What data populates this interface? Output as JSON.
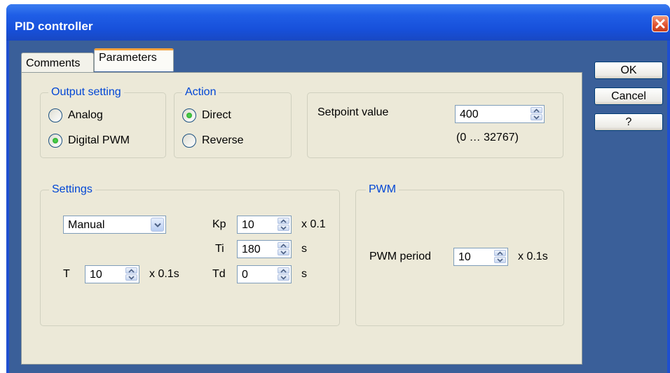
{
  "window": {
    "title": "PID controller"
  },
  "tabs": [
    {
      "label": "Comments",
      "active": false
    },
    {
      "label": "Parameters",
      "active": true
    }
  ],
  "buttons": {
    "ok": "OK",
    "cancel": "Cancel",
    "help": "?"
  },
  "output_setting": {
    "legend": "Output setting",
    "options": [
      {
        "label": "Analog",
        "checked": false
      },
      {
        "label": "Digital PWM",
        "checked": true
      }
    ]
  },
  "action": {
    "legend": "Action",
    "options": [
      {
        "label": "Direct",
        "checked": true
      },
      {
        "label": "Reverse",
        "checked": false
      }
    ]
  },
  "setpoint": {
    "label": "Setpoint value",
    "value": "400",
    "range": "(0 … 32767)"
  },
  "settings": {
    "legend": "Settings",
    "mode": "Manual",
    "kp": {
      "label": "Kp",
      "value": "10",
      "unit": "x 0.1"
    },
    "ti": {
      "label": "Ti",
      "value": "180",
      "unit": "s"
    },
    "td": {
      "label": "Td",
      "value": "0",
      "unit": "s"
    },
    "t": {
      "label": "T",
      "value": "10",
      "unit": "x 0.1s"
    }
  },
  "pwm": {
    "legend": "PWM",
    "period": {
      "label": "PWM period",
      "value": "10",
      "unit": "x 0.1s"
    }
  },
  "colors": {
    "titlebar": "#1f5ee6",
    "legend_text": "#0046d5",
    "panel": "#ece9d8",
    "radio_dot": "#21a121",
    "close": "#e0512e"
  },
  "icons": {
    "close": "close-icon",
    "spin_up": "chevron-up-icon",
    "spin_down": "chevron-down-icon",
    "dropdown": "chevron-down-icon"
  }
}
